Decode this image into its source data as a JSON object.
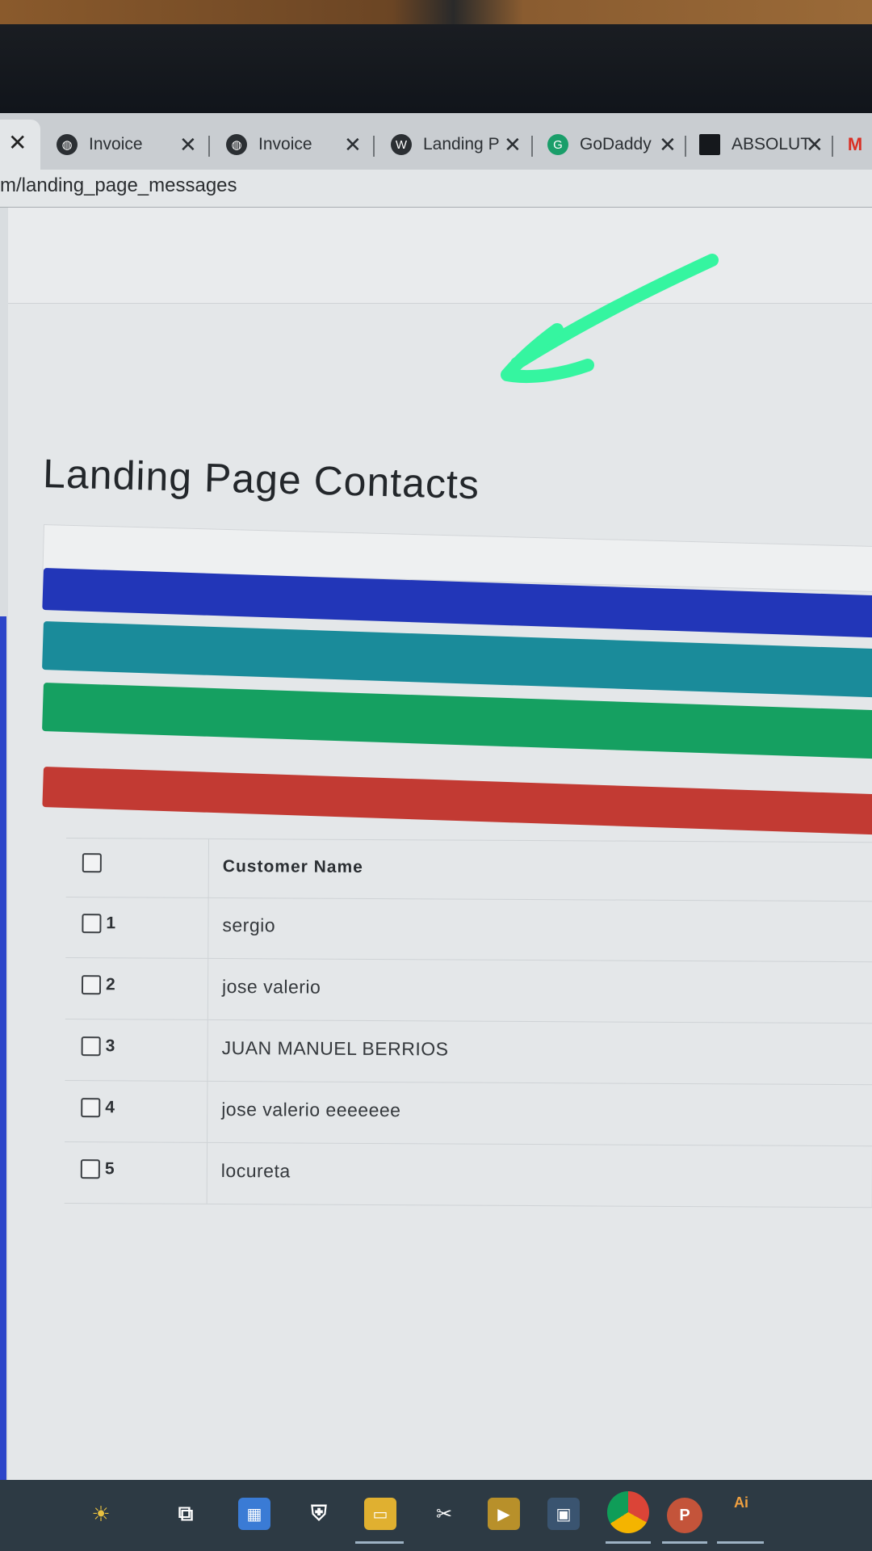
{
  "browser": {
    "tabs": [
      {
        "label": "Invoice",
        "icon": "globe-icon"
      },
      {
        "label": "Invoice",
        "icon": "globe-icon"
      },
      {
        "label": "Landing P",
        "icon": "wordpress-icon"
      },
      {
        "label": "GoDaddy",
        "icon": "godaddy-icon"
      },
      {
        "label": "ABSOLUT",
        "icon": "square-icon"
      }
    ],
    "url": "m/landing_page_messages",
    "close_glyph": "✕"
  },
  "page": {
    "title": "Landing Page Contacts"
  },
  "table": {
    "header": {
      "name": "Customer Name"
    },
    "rows": [
      {
        "num": "1",
        "name": "sergio"
      },
      {
        "num": "2",
        "name": "jose valerio"
      },
      {
        "num": "3",
        "name": "JUAN MANUEL BERRIOS"
      },
      {
        "num": "4",
        "name": "jose valerio eeeeeee"
      },
      {
        "num": "5",
        "name": "locureta"
      }
    ]
  },
  "taskbar": {
    "ai_label": "Ai"
  },
  "colors": {
    "blue_bar": "#2236b8",
    "teal_bar": "#1a8b9a",
    "green_bar": "#15a061",
    "red_bar": "#c23a33",
    "annotation_arrow": "#35f5a0"
  }
}
